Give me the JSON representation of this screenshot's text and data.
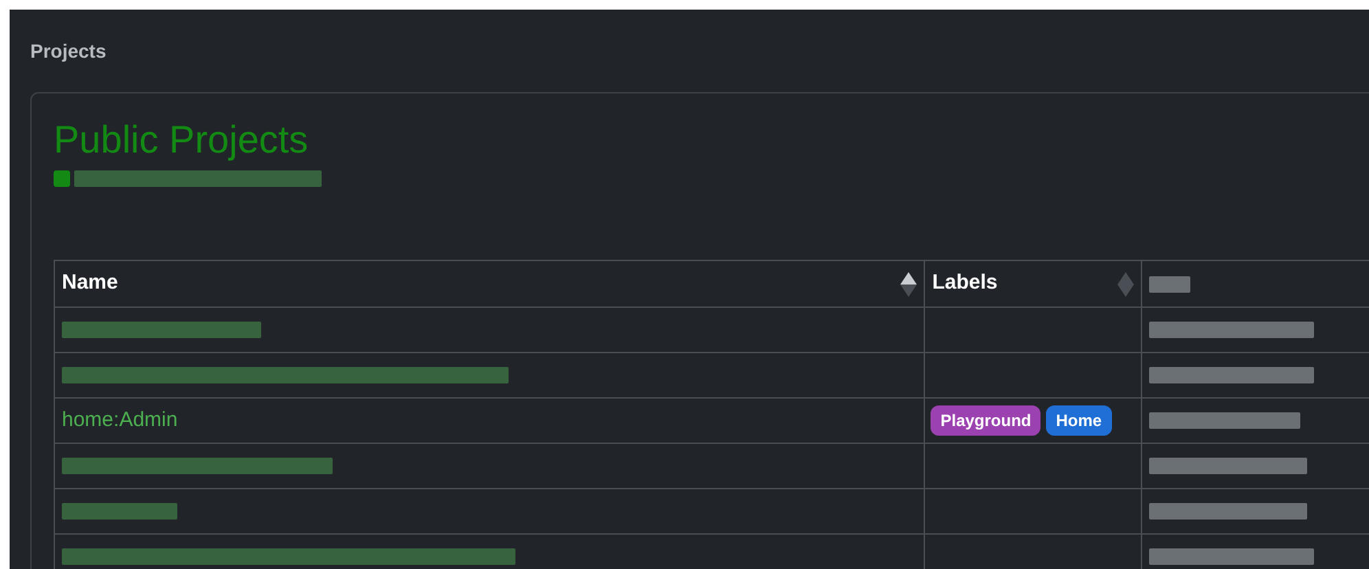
{
  "page_title": "Projects",
  "card": {
    "title": "Public Projects",
    "filter_checkbox": {
      "checked": true,
      "label_redacted": true
    }
  },
  "table": {
    "columns": [
      {
        "label": "Name",
        "sorted_ascending": true,
        "redacted": false
      },
      {
        "label": "Labels",
        "sorted_ascending": false,
        "redacted": false
      },
      {
        "redacted": true
      }
    ],
    "rows": [
      {
        "kind": "redacted"
      },
      {
        "kind": "redacted"
      },
      {
        "kind": "text",
        "name": "home:Admin",
        "labels": [
          {
            "text": "Playground",
            "color": "#9b41b0"
          },
          {
            "text": "Home",
            "color": "#1f6fd6"
          }
        ]
      },
      {
        "kind": "redacted"
      },
      {
        "kind": "redacted"
      },
      {
        "kind": "redacted"
      }
    ]
  }
}
